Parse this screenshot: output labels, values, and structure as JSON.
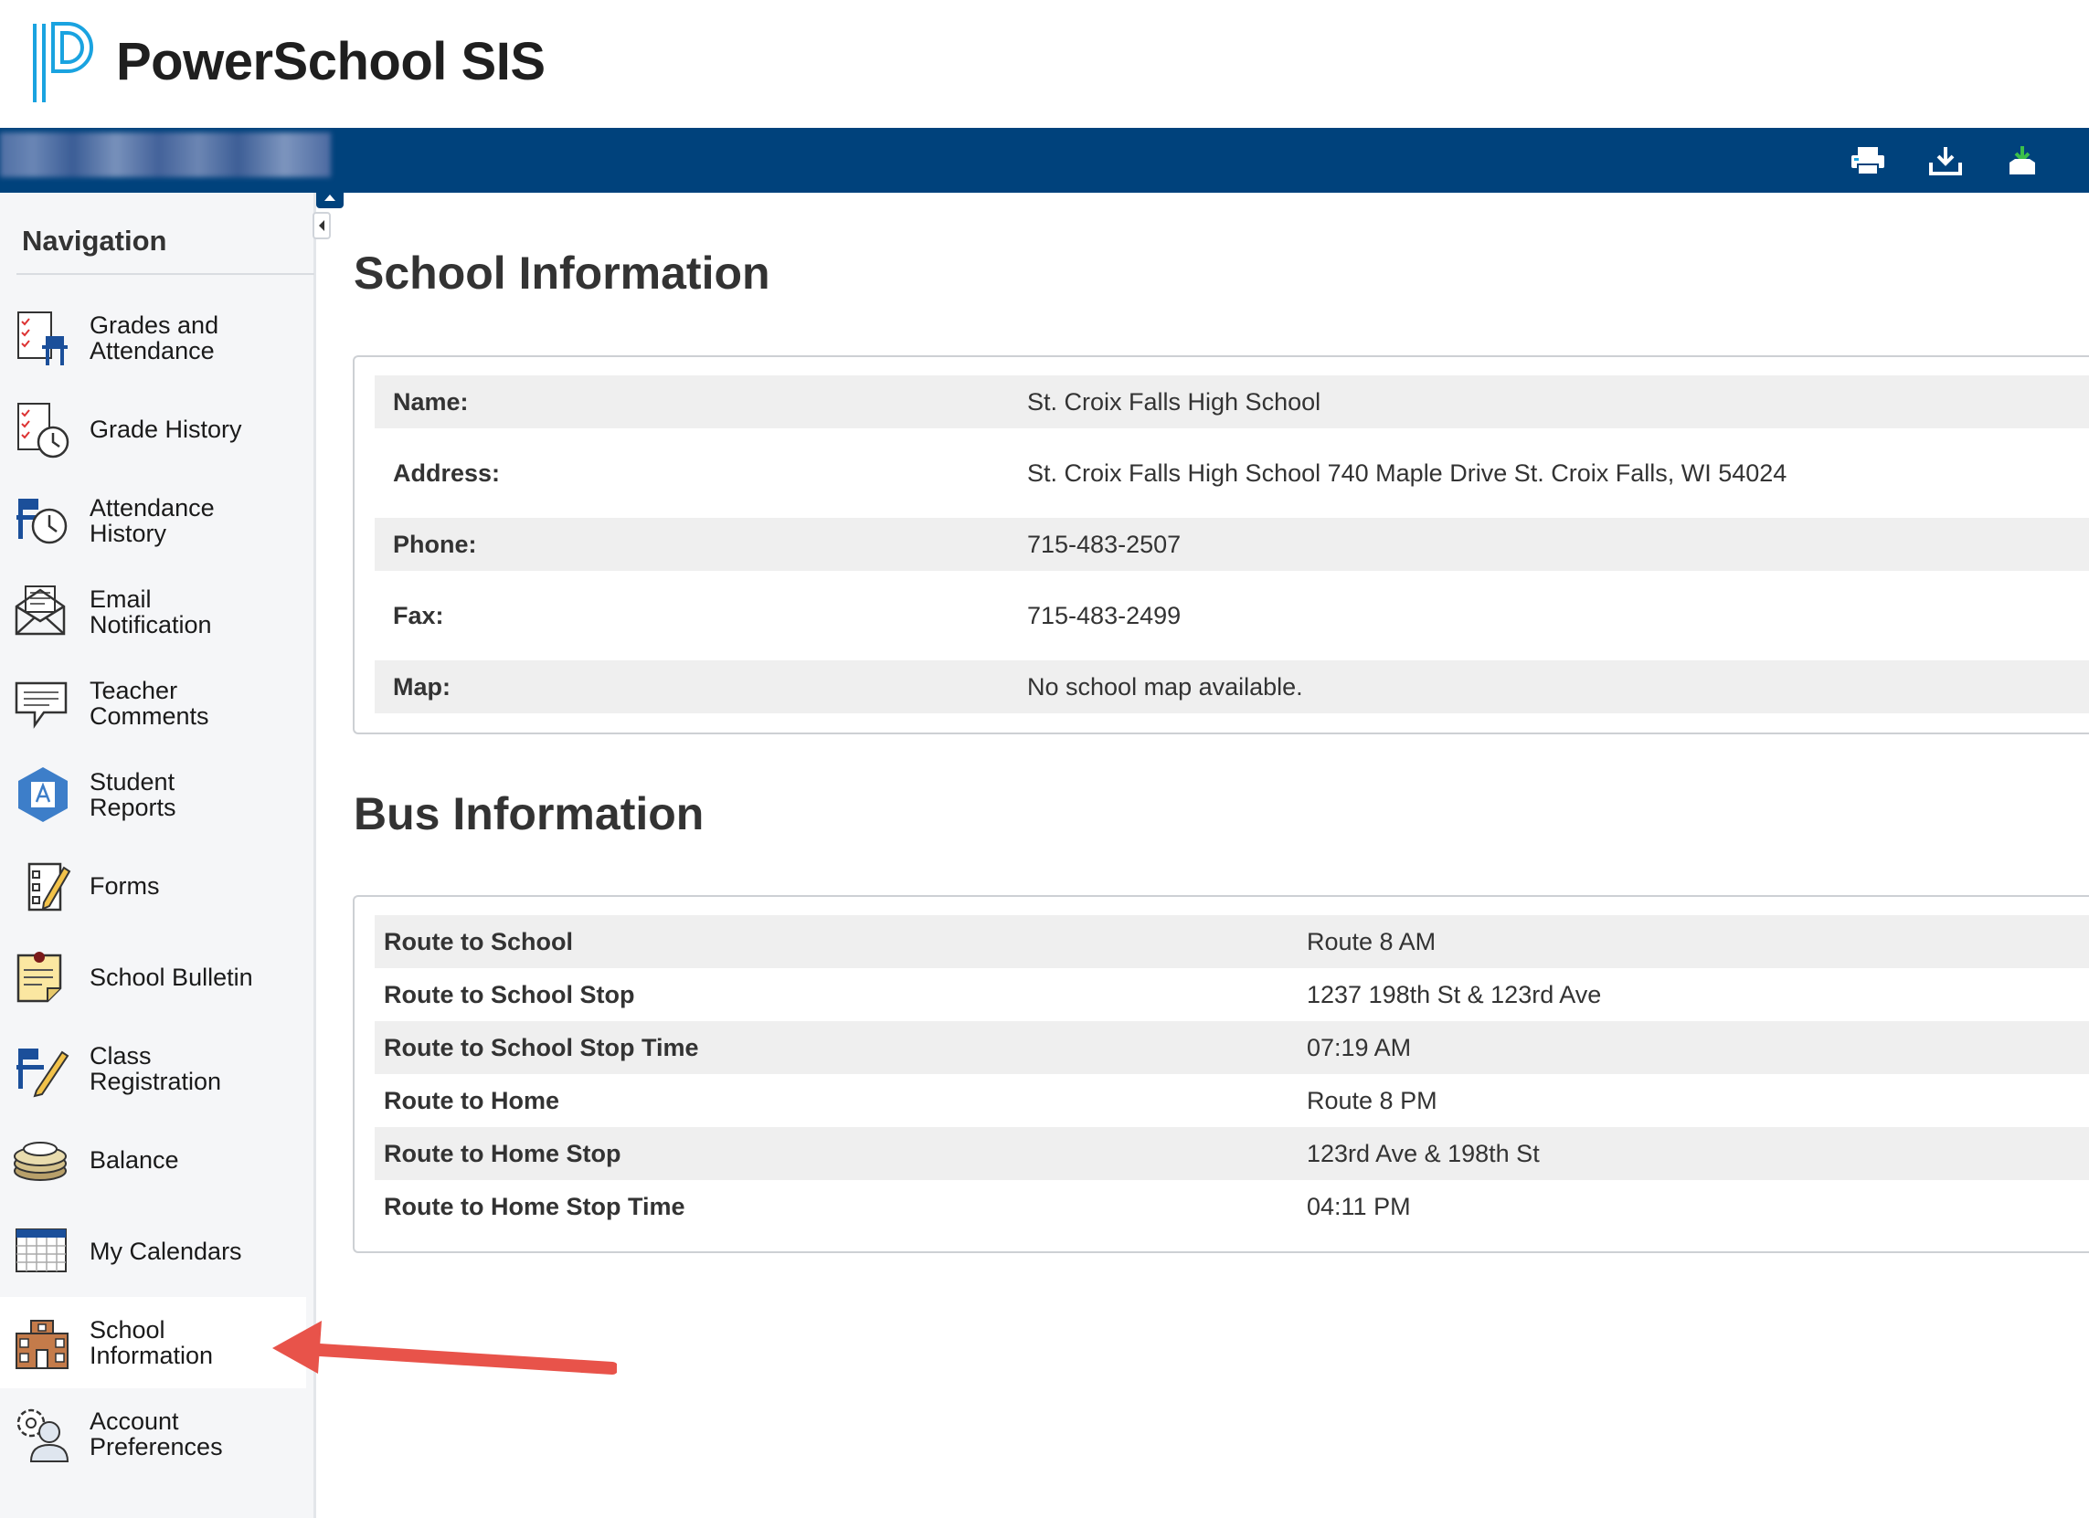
{
  "app": {
    "title": "PowerSchool SIS"
  },
  "toolbar": {
    "icons": [
      "printer-icon",
      "download-icon",
      "download-green-icon"
    ]
  },
  "nav": {
    "title": "Navigation",
    "items": [
      {
        "label": "Grades and Attendance",
        "icon": "grades-attendance-icon"
      },
      {
        "label": "Grade History",
        "icon": "grade-history-icon"
      },
      {
        "label": "Attendance History",
        "icon": "attendance-history-icon"
      },
      {
        "label": "Email Notification",
        "icon": "email-icon"
      },
      {
        "label": "Teacher Comments",
        "icon": "comments-icon"
      },
      {
        "label": "Student Reports",
        "icon": "student-reports-icon"
      },
      {
        "label": "Forms",
        "icon": "forms-icon"
      },
      {
        "label": "School Bulletin",
        "icon": "bulletin-icon"
      },
      {
        "label": "Class Registration",
        "icon": "class-registration-icon"
      },
      {
        "label": "Balance",
        "icon": "balance-icon"
      },
      {
        "label": "My Calendars",
        "icon": "calendar-icon"
      },
      {
        "label": "School Information",
        "icon": "school-icon"
      },
      {
        "label": "Account Preferences",
        "icon": "account-preferences-icon"
      }
    ]
  },
  "school": {
    "heading": "School Information",
    "rows": [
      {
        "label": "Name:",
        "value": "St. Croix Falls High School"
      },
      {
        "label": "Address:",
        "value": "St. Croix Falls High School 740 Maple Drive St. Croix Falls, WI 54024"
      },
      {
        "label": "Phone:",
        "value": "715-483-2507"
      },
      {
        "label": "Fax:",
        "value": "715-483-2499"
      },
      {
        "label": "Map:",
        "value": "No school map available."
      }
    ]
  },
  "bus": {
    "heading": "Bus Information",
    "rows": [
      {
        "label": "Route to School",
        "value": "Route 8 AM"
      },
      {
        "label": "Route to School Stop",
        "value": "1237 198th St & 123rd Ave"
      },
      {
        "label": "Route to School Stop Time",
        "value": "07:19 AM"
      },
      {
        "label": "Route to Home",
        "value": "Route 8 PM"
      },
      {
        "label": "Route to Home Stop",
        "value": "123rd Ave & 198th St"
      },
      {
        "label": "Route to Home Stop Time",
        "value": "04:11 PM"
      }
    ]
  },
  "colors": {
    "brand_bar": "#00427c",
    "logo": "#1aa3e0",
    "arrow": "#e8534a"
  }
}
